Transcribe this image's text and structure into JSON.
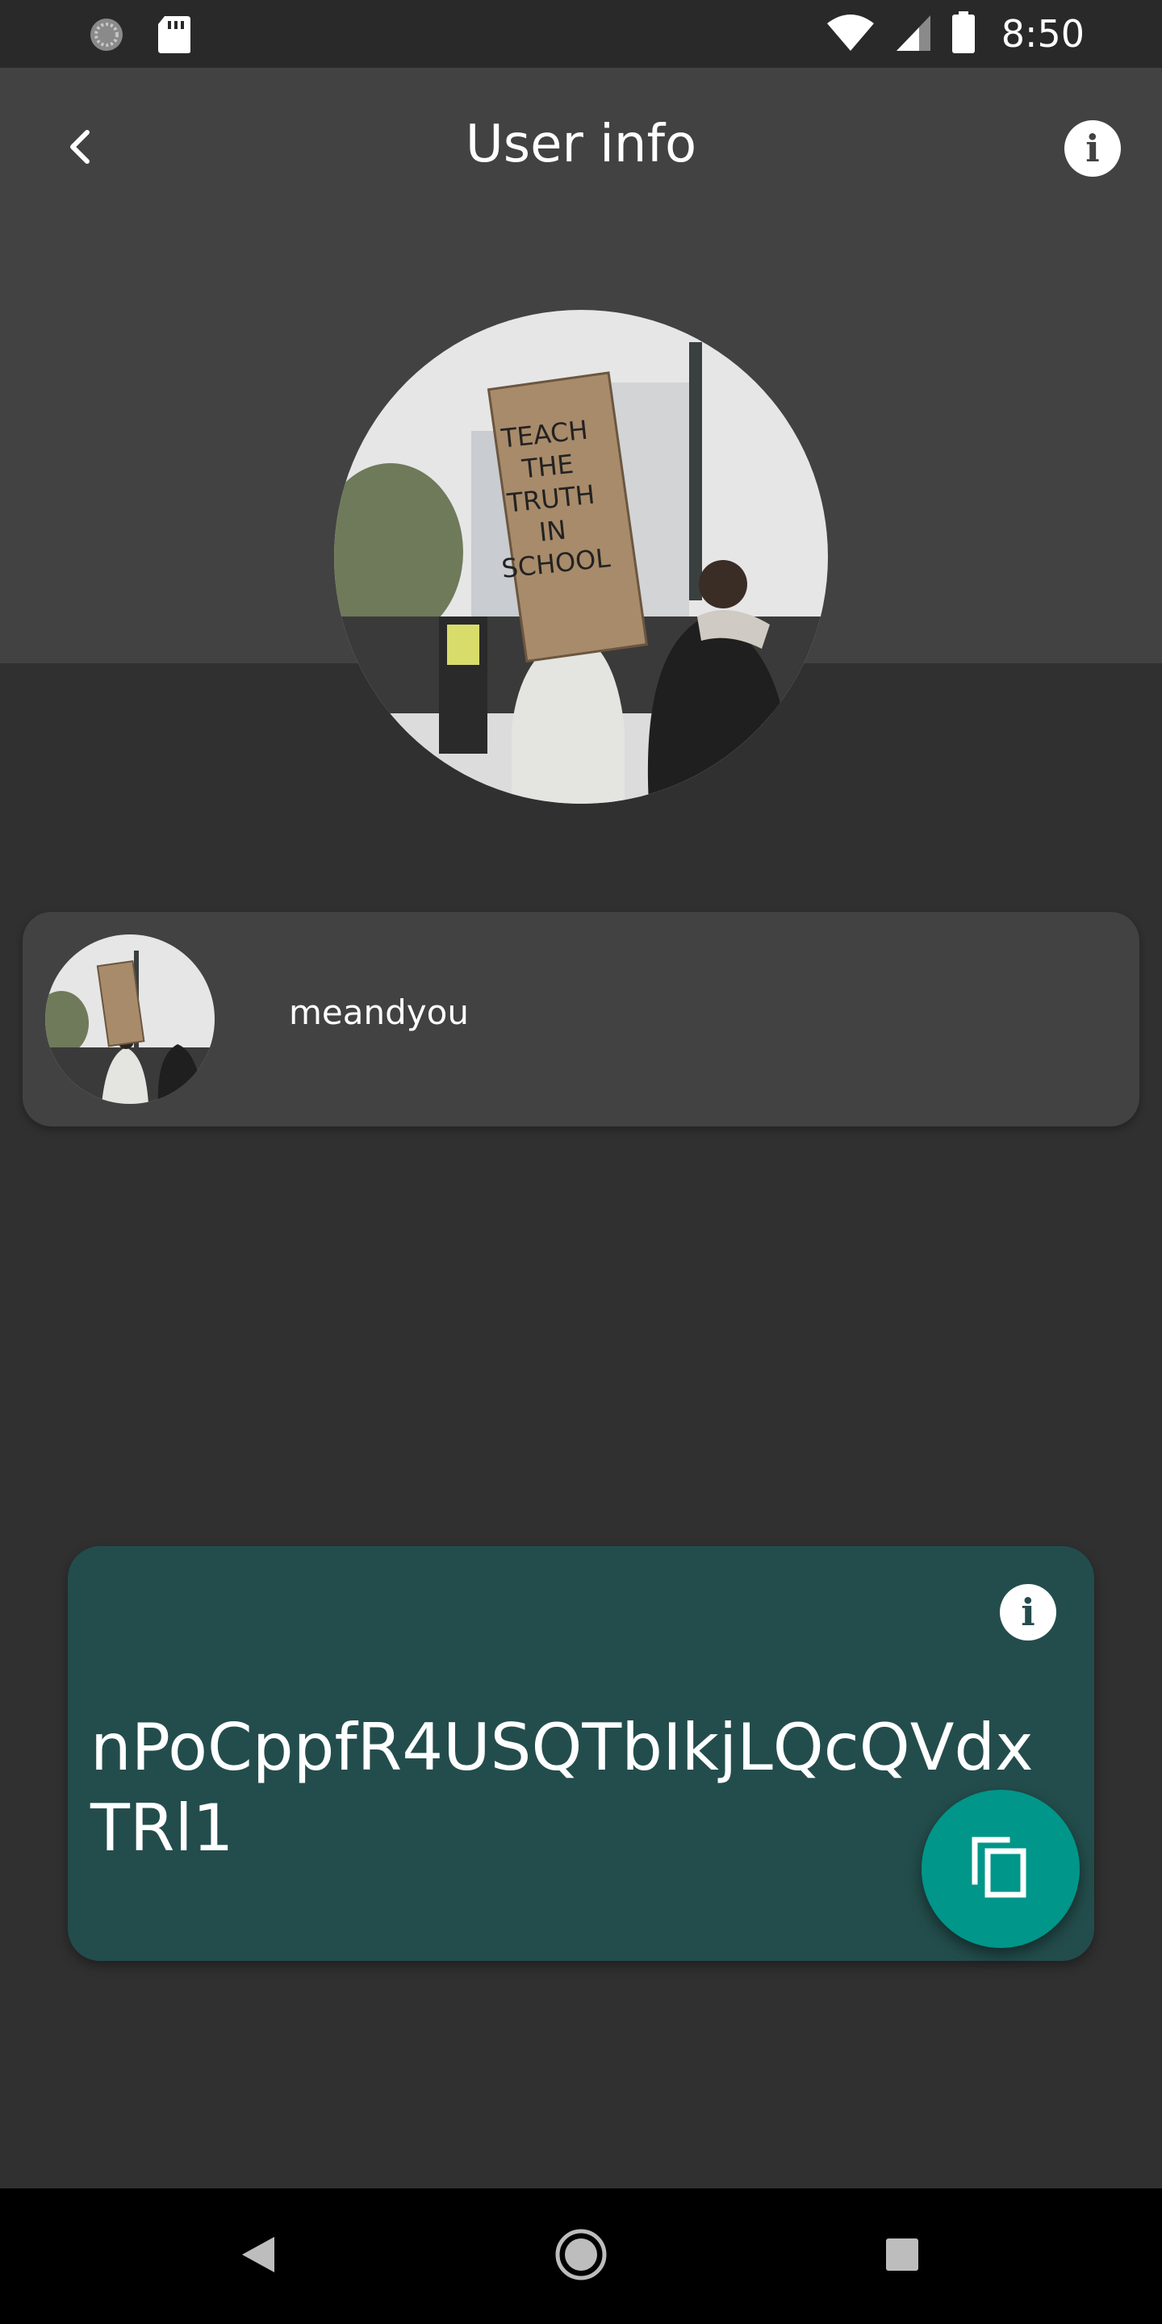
{
  "status_bar": {
    "time": "8:50",
    "left_icons": [
      "loading-icon",
      "sd-card-icon"
    ],
    "right_icons": [
      "wifi-icon",
      "signal-icon",
      "battery-icon"
    ]
  },
  "app_bar": {
    "title": "User info",
    "back_icon": "chevron-left-icon",
    "info_icon": "info-icon",
    "info_glyph": "i"
  },
  "user": {
    "username": "meandyou",
    "avatar_sign_text": [
      "TEACH",
      "THE",
      "TRUTH",
      "IN",
      "SCHOOL"
    ]
  },
  "id_card": {
    "id_text": "nPoCppfR4USQTbIkjLQcQVdxTRl1",
    "info_glyph": "i",
    "copy_icon": "copy-icon"
  },
  "nav_bar": {
    "buttons": [
      "back-icon",
      "home-icon",
      "recents-icon"
    ]
  },
  "colors": {
    "background": "#303030",
    "app_bar": "#424242",
    "card": "#424242",
    "id_card": "#234d4c",
    "fab": "#00968a"
  }
}
